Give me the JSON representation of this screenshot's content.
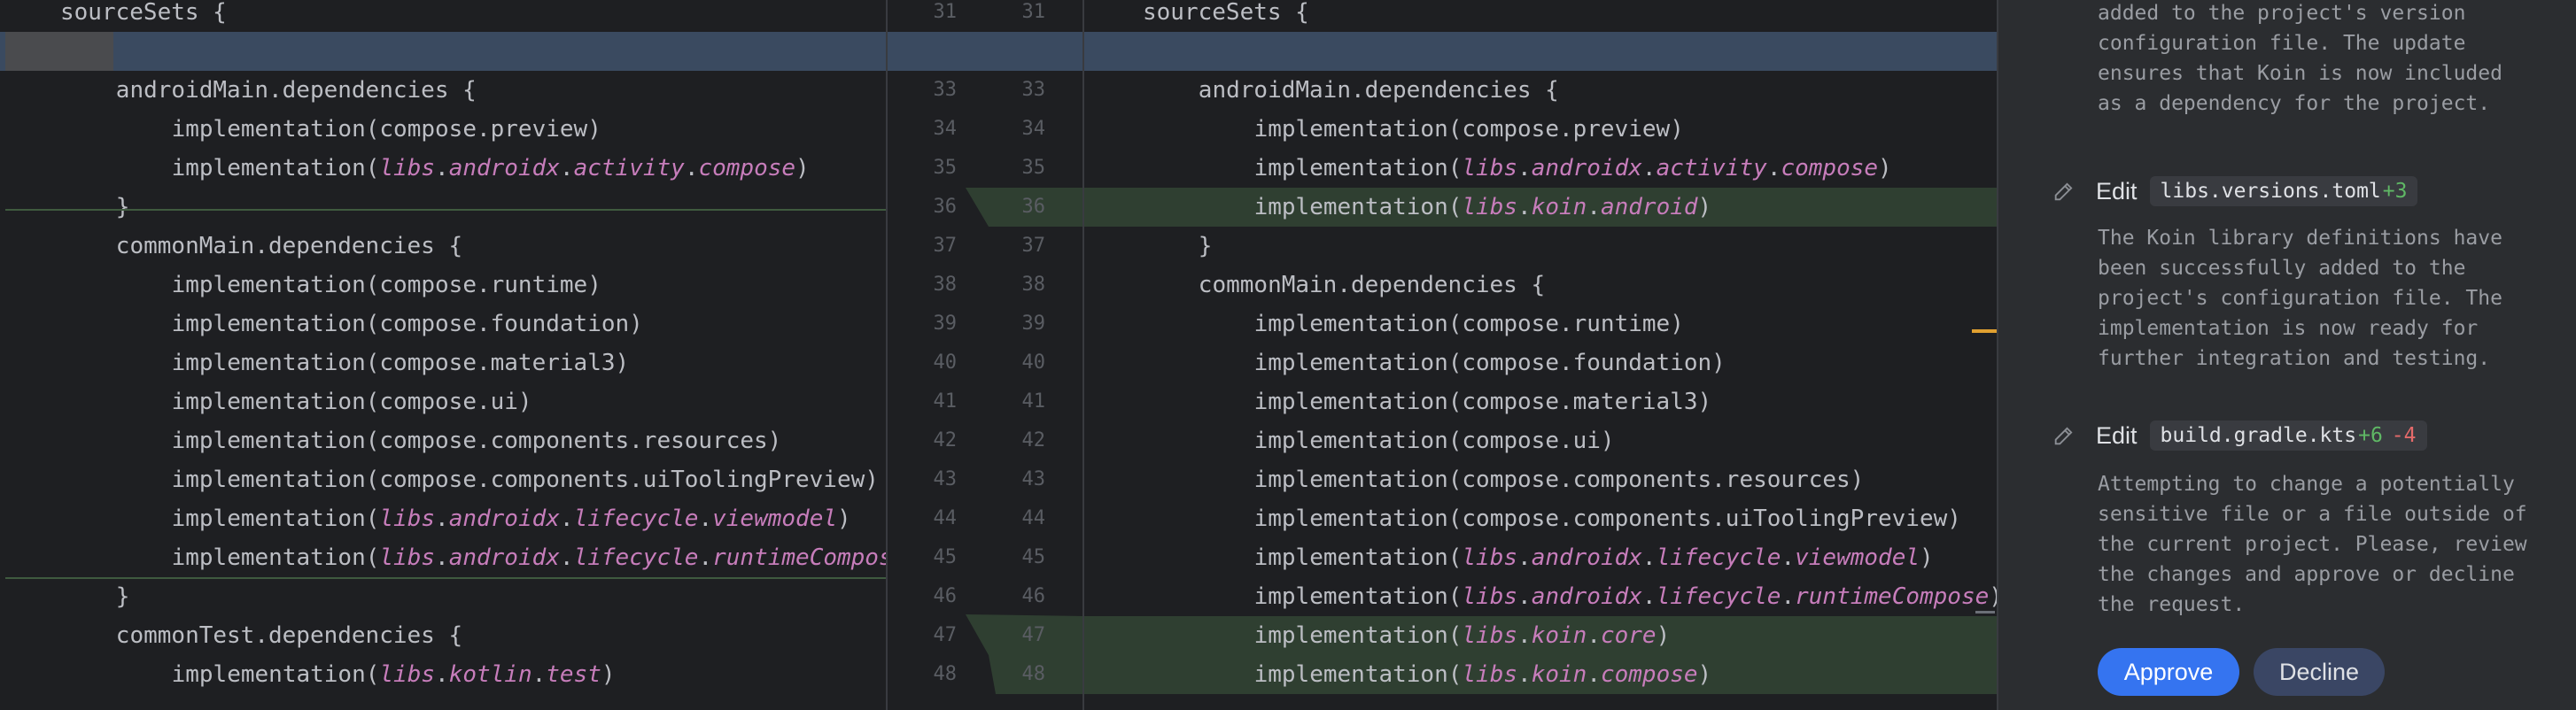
{
  "colors": {
    "background": "#1e1f22",
    "panel": "#2b2d30",
    "added_line": "#2f3f31",
    "highlight_line": "#3a4a60",
    "lib_ref": "#c77dbb",
    "approve": "#3574f0",
    "decline": "#3a4664"
  },
  "left": {
    "lines": [
      "sourceSets {",
      "",
      "androidMain.dependencies {",
      "implementation(compose.preview)",
      "implementation(libs.androidx.activity.compose)",
      "}",
      "commonMain.dependencies {",
      "implementation(compose.runtime)",
      "implementation(compose.foundation)",
      "implementation(compose.material3)",
      "implementation(compose.ui)",
      "implementation(compose.components.resources)",
      "implementation(compose.components.uiToolingPreview)",
      "implementation(libs.androidx.lifecycle.viewmodel)",
      "implementation(libs.androidx.lifecycle.runtimeCompos",
      "}",
      "commonTest.dependencies {",
      "implementation(libs.kotlin.test)"
    ]
  },
  "gutter": {
    "left_numbers": [
      "31",
      "",
      "33",
      "34",
      "35",
      "36",
      "37",
      "38",
      "39",
      "40",
      "41",
      "42",
      "43",
      "44",
      "45",
      "46",
      "47",
      "48"
    ],
    "right_numbers": [
      "31",
      "",
      "33",
      "34",
      "35",
      "36",
      "37",
      "38",
      "39",
      "40",
      "41",
      "42",
      "43",
      "44",
      "45",
      "46",
      "47",
      "48"
    ]
  },
  "right": {
    "lines": [
      "sourceSets {",
      "",
      "androidMain.dependencies {",
      "implementation(compose.preview)",
      "implementation(libs.androidx.activity.compose)",
      "implementation(libs.koin.android)",
      "}",
      "commonMain.dependencies {",
      "implementation(compose.runtime)",
      "implementation(compose.foundation)",
      "implementation(compose.material3)",
      "implementation(compose.ui)",
      "implementation(compose.components.resources)",
      "implementation(compose.components.uiToolingPreview)",
      "implementation(libs.androidx.lifecycle.viewmodel)",
      "implementation(libs.androidx.lifecycle.runtimeCompose)",
      "implementation(libs.koin.core)",
      "implementation(libs.koin.compose)"
    ]
  },
  "ai": {
    "top_text": "added to the project's version\nconfiguration file. The update\nensures that Koin is now included\nas a dependency for the project.",
    "edit1": {
      "label": "Edit",
      "file": "libs.versions.toml",
      "added": "+3"
    },
    "text1": "The Koin library definitions have\nbeen successfully added to the\nproject's configuration file. The\nimplementation is now ready for\nfurther integration and testing.",
    "edit2": {
      "label": "Edit",
      "file": "build.gradle.kts",
      "added": "+6",
      "removed": "-4"
    },
    "text2": "Attempting to change a potentially\nsensitive file or a file outside of\nthe current project. Please, review\nthe changes and approve or decline\nthe request.",
    "approve_label": "Approve",
    "decline_label": "Decline"
  }
}
